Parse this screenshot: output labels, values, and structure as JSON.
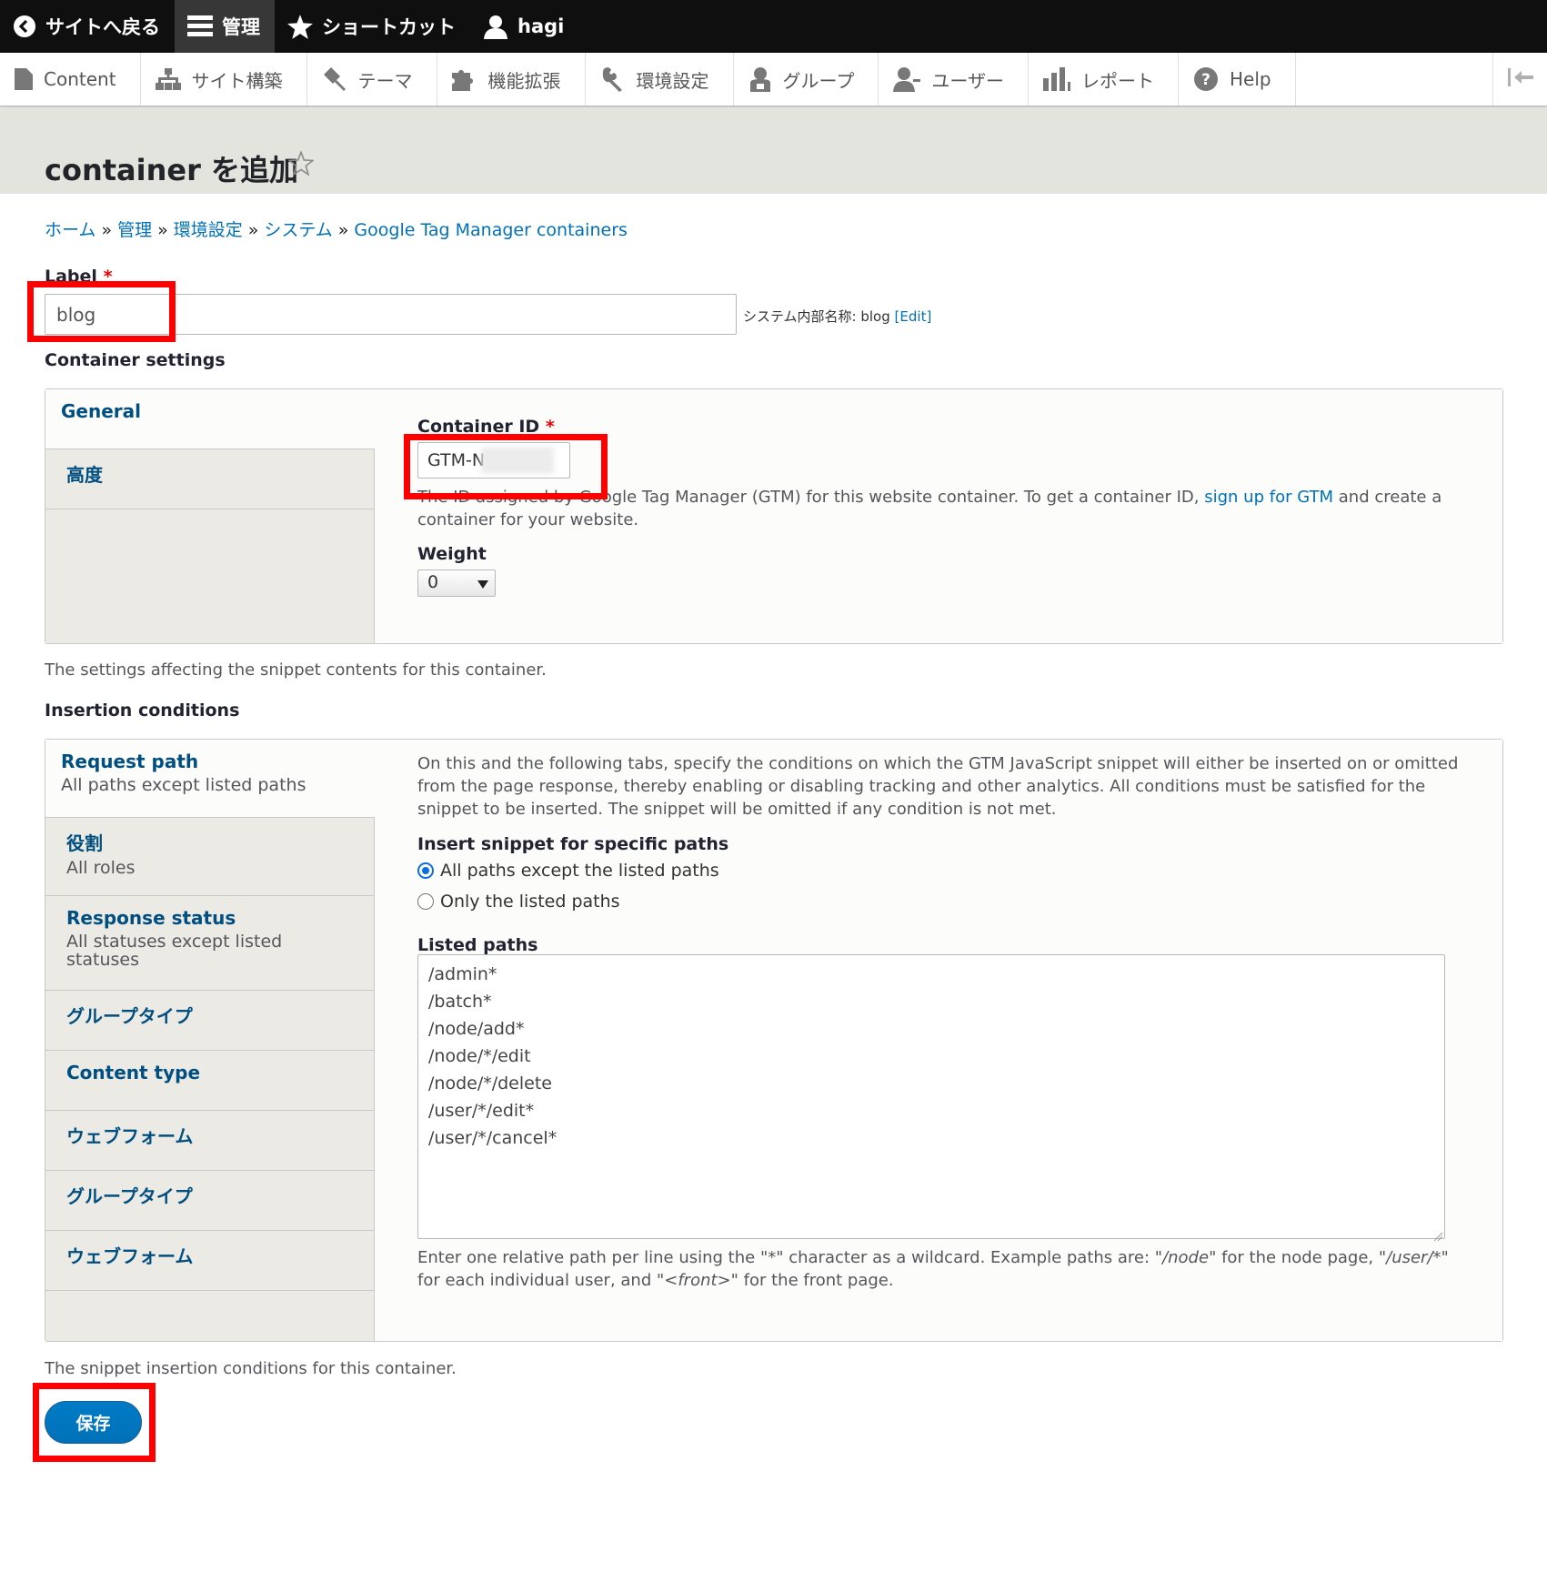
{
  "admin_toolbar": {
    "items": [
      {
        "label": "サイトへ戻る",
        "icon": "back-circle-icon"
      },
      {
        "label": "管理",
        "icon": "hamburger-icon"
      },
      {
        "label": "ショートカット",
        "icon": "star-icon"
      },
      {
        "label": "hagi",
        "icon": "user-icon"
      }
    ]
  },
  "admin_tray": {
    "items": [
      {
        "label": "Content",
        "icon": "page-icon"
      },
      {
        "label": "サイト構築",
        "icon": "sitemap-icon"
      },
      {
        "label": "テーマ",
        "icon": "paintbrush-icon"
      },
      {
        "label": "機能拡張",
        "icon": "puzzle-icon"
      },
      {
        "label": "環境設定",
        "icon": "wrench-icon"
      },
      {
        "label": "グループ",
        "icon": "group-icon"
      },
      {
        "label": "ユーザー",
        "icon": "users-icon"
      },
      {
        "label": "レポート",
        "icon": "bar-chart-icon"
      },
      {
        "label": "Help",
        "icon": "help-icon"
      }
    ]
  },
  "page": {
    "title": "container を追加"
  },
  "breadcrumb": [
    "ホーム",
    "管理",
    "環境設定",
    "システム",
    "Google Tag Manager containers"
  ],
  "breadcrumb_separator": "»",
  "form": {
    "label_field": {
      "label": "Label",
      "required_mark": "*",
      "value": "blog",
      "machine_name_prefix": "システム内部名称: blog",
      "machine_name_edit": "[Edit]"
    },
    "container_settings": {
      "title": "Container settings",
      "tabs": [
        {
          "title": "General"
        },
        {
          "title": "高度"
        }
      ],
      "container_id": {
        "label": "Container ID",
        "required_mark": "*",
        "value": "GTM-N",
        "desc_before": "The ID assigned by Google Tag Manager (GTM) for this website container. To get a container ID, ",
        "desc_link": "sign up for GTM",
        "desc_after": " and create a container for your website."
      },
      "weight": {
        "label": "Weight",
        "value": "0"
      },
      "description": "The settings affecting the snippet contents for this container."
    },
    "insertion_conditions": {
      "title": "Insertion conditions",
      "tabs": [
        {
          "title": "Request path",
          "summary": "All paths except listed paths"
        },
        {
          "title": "役割",
          "summary": "All roles"
        },
        {
          "title": "Response status",
          "summary": "All statuses except listed statuses"
        },
        {
          "title": "グループタイプ",
          "summary": ""
        },
        {
          "title": "Content type",
          "summary": ""
        },
        {
          "title": "ウェブフォーム",
          "summary": ""
        },
        {
          "title": "グループタイプ",
          "summary": ""
        },
        {
          "title": "ウェブフォーム",
          "summary": ""
        }
      ],
      "intro": "On this and the following tabs, specify the conditions on which the GTM JavaScript snippet will either be inserted on or omitted from the page response, thereby enabling or disabling tracking and other analytics. All conditions must be satisfied for the snippet to be inserted. The snippet will be omitted if any condition is not met.",
      "insert_label": "Insert snippet for specific paths",
      "options": [
        {
          "label": "All paths except the listed paths",
          "checked": true
        },
        {
          "label": "Only the listed paths",
          "checked": false
        }
      ],
      "listed_paths_label": "Listed paths",
      "listed_paths": [
        "/admin*",
        "/batch*",
        "/node/add*",
        "/node/*/edit",
        "/node/*/delete",
        "/user/*/edit*",
        "/user/*/cancel*"
      ],
      "help": {
        "p1": "Enter one relative path per line using the \"*\" character as a wildcard. Example paths are: \"",
        "e1": "/node",
        "p2": "\" for the node page, \"",
        "e2": "/user/*",
        "p3": "\" for each individual user, and \"",
        "e3": "<front>",
        "p4": "\" for the front page."
      },
      "description": "The snippet insertion conditions for this container."
    },
    "save_label": "保存"
  },
  "colors": {
    "link": "#0071b8",
    "highlight": "#ff0000",
    "topbar": "#0f0f0f",
    "header_bg": "#e4e4de"
  }
}
